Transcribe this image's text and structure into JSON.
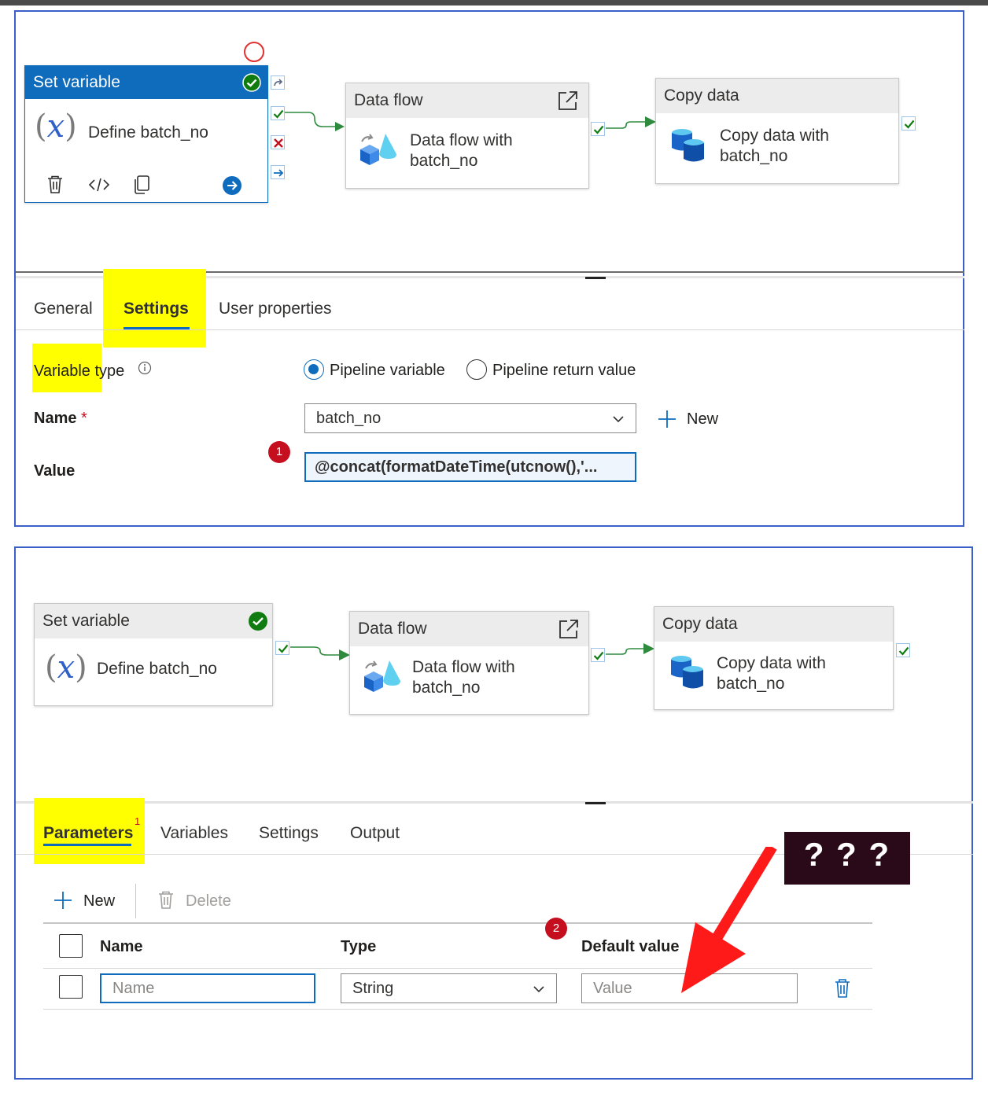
{
  "top_panel": {
    "set_variable": {
      "title": "Set variable",
      "text": "Define batch_no"
    },
    "data_flow": {
      "title": "Data flow",
      "text_line1": "Data flow with",
      "text_line2": "batch_no"
    },
    "copy_data": {
      "title": "Copy data",
      "text_line1": "Copy data with",
      "text_line2": "batch_no"
    },
    "tabs": [
      "General",
      "Settings",
      "User properties"
    ],
    "form": {
      "variable_type_label_part1": "Variable",
      "variable_type_label_part2": " type",
      "radio_pipeline_variable": "Pipeline variable",
      "radio_return_value": "Pipeline return value",
      "name_label": "Name",
      "required_mark": "*",
      "name_value": "batch_no",
      "new_label": "New",
      "value_label": "Value",
      "value_value": "@concat(formatDateTime(utcnow(),'...",
      "badge": "1"
    }
  },
  "bottom_panel": {
    "set_variable": {
      "title": "Set variable",
      "text": "Define batch_no"
    },
    "data_flow": {
      "title": "Data flow",
      "text_line1": "Data flow with",
      "text_line2": "batch_no"
    },
    "copy_data": {
      "title": "Copy data",
      "text_line1": "Copy data with",
      "text_line2": "batch_no"
    },
    "tabs": [
      "Parameters",
      "Variables",
      "Settings",
      "Output"
    ],
    "parameters_superscript": "1",
    "toolbar": {
      "new_label": "New",
      "delete_label": "Delete"
    },
    "table": {
      "headers": [
        "Name",
        "Type",
        "Default value"
      ],
      "row": {
        "name_placeholder": "Name",
        "type_value": "String",
        "value_placeholder": "Value"
      }
    },
    "badge": "2",
    "annotation": "? ? ?"
  },
  "colors": {
    "accent": "#0f6cbd",
    "highlight": "#ffff00",
    "success": "#107c10",
    "error": "#c50f1f",
    "arrow": "#ff0000"
  }
}
